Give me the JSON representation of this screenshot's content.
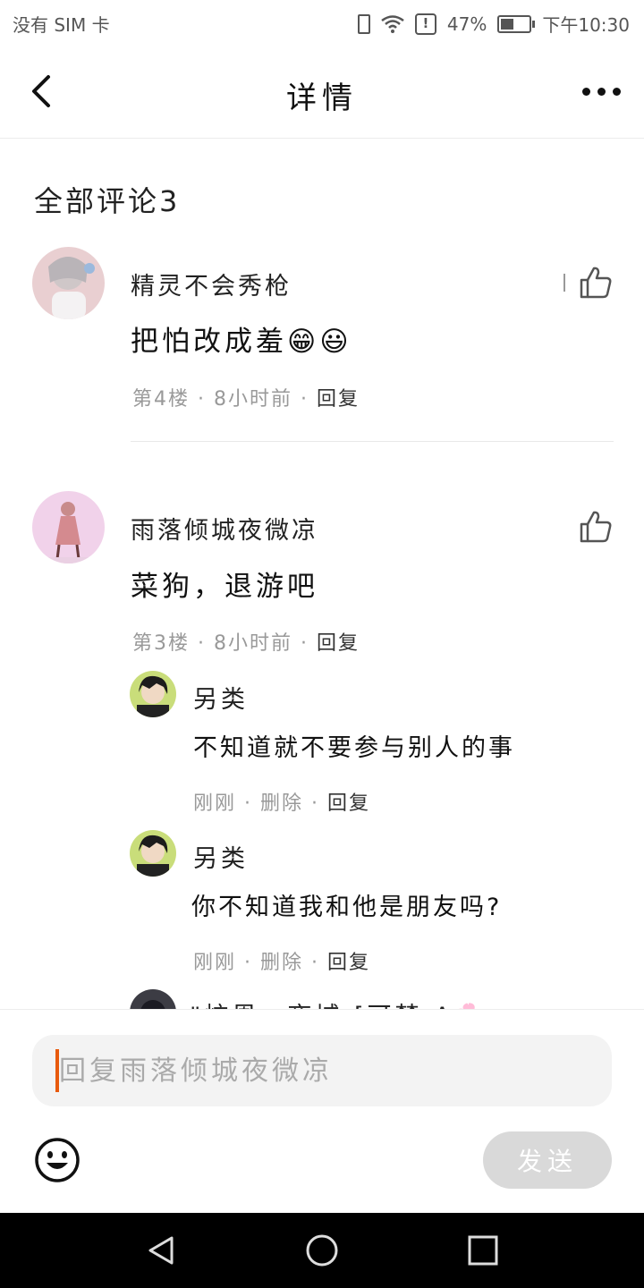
{
  "status_bar": {
    "carrier": "没有 SIM 卡",
    "battery": "47%",
    "battery_level": 0.47,
    "time": "下午10:30"
  },
  "header": {
    "title": "详情"
  },
  "comments": {
    "section_title": "全部评论3",
    "items": [
      {
        "name": "精灵不会秀枪",
        "content": "把怕改成羞😁😃",
        "floor": "第4楼",
        "time": "8小时前",
        "reply_label": "回复"
      },
      {
        "name": "雨落倾城夜微凉",
        "content": "菜狗，退游吧",
        "floor": "第3楼",
        "time": "8小时前",
        "reply_label": "回复",
        "replies": [
          {
            "name": "另类",
            "content": "不知道就不要参与别人的事",
            "time": "刚刚",
            "delete_label": "删除",
            "reply_label": "回复"
          },
          {
            "name": "另类",
            "content": "你不知道我和他是朋友吗?",
            "time": "刚刚",
            "delete_label": "删除",
            "reply_label": "回复"
          },
          {
            "name": "\"炫恩，夜城 [可梦 A🌸"
          }
        ]
      }
    ]
  },
  "composer": {
    "placeholder": "回复雨落倾城夜微凉",
    "send_label": "发送"
  },
  "icons": {
    "back": "chevron-left-icon",
    "more": "more-horizontal-icon",
    "like": "thumbs-up-icon",
    "emoji": "smiley-icon"
  },
  "colors": {
    "accent": "#e85a0c",
    "send_disabled": "#d9d9d9"
  }
}
